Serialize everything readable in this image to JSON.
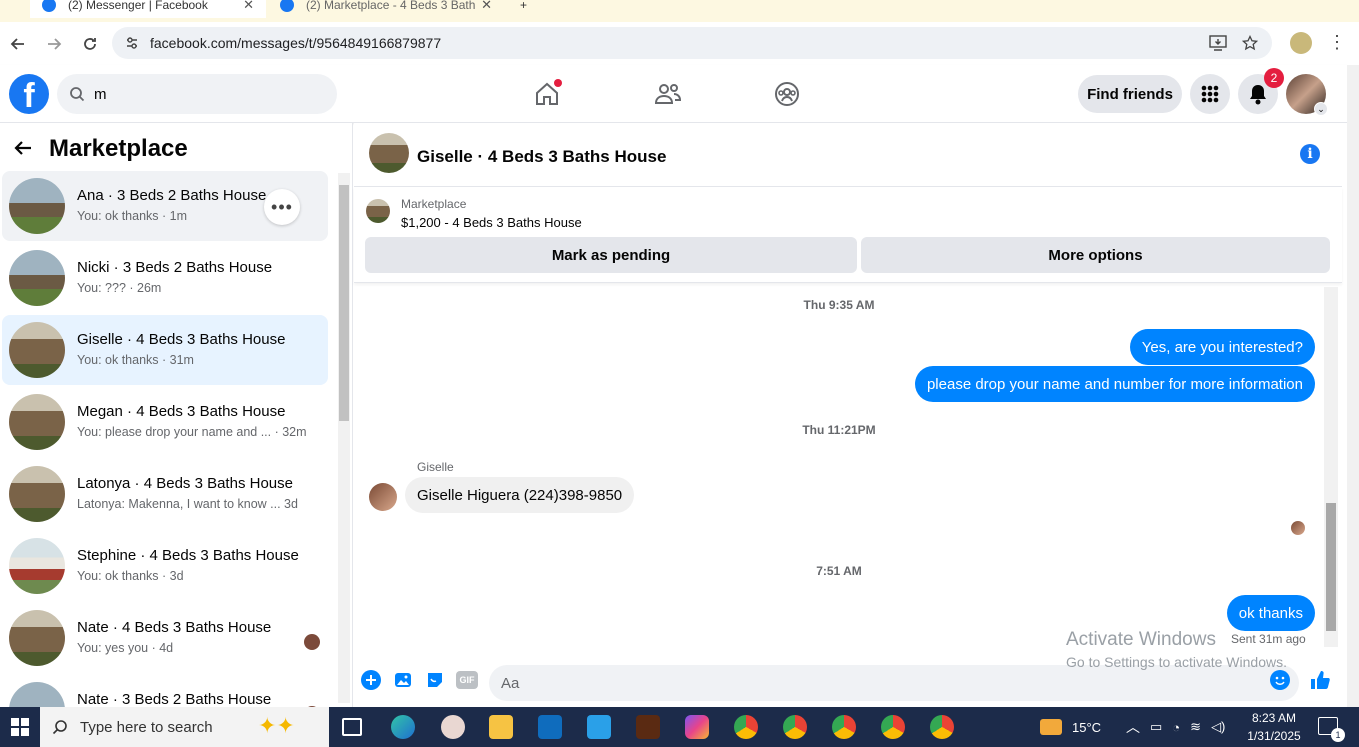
{
  "browser": {
    "tabs": [
      {
        "label": "(2) Messenger | Facebook"
      },
      {
        "label": "(2) Marketplace - 4 Beds 3 Bath"
      }
    ],
    "url": "facebook.com/messages/t/9564849166879877"
  },
  "header": {
    "search_value": "m",
    "find_friends_label": "Find friends",
    "notification_count": "2"
  },
  "sidebar": {
    "title": "Marketplace",
    "conversations": [
      {
        "name": "Ana · 3 Beds 2 Baths House",
        "preview": "You: ok thanks · 1m"
      },
      {
        "name": "Nicki · 3 Beds 2 Baths House",
        "preview": "You: ??? · 26m"
      },
      {
        "name": "Giselle · 4 Beds 3 Baths House",
        "preview": "You: ok thanks · 31m"
      },
      {
        "name": "Megan · 4 Beds 3 Baths House",
        "preview": "You: please drop your name and ... · 32m"
      },
      {
        "name": "Latonya · 4 Beds 3 Baths House",
        "preview": "Latonya: Makenna, I want to know ...  3d"
      },
      {
        "name": "Stephine · 4 Beds 3 Baths House",
        "preview": "You: ok thanks · 3d"
      },
      {
        "name": "Nate · 4 Beds 3 Baths House",
        "preview": "You: yes you · 4d"
      },
      {
        "name": "Nate · 3 Beds 2 Baths House",
        "preview": ""
      }
    ]
  },
  "chat": {
    "title": "Giselle · 4 Beds 3 Baths House",
    "marketplace_label": "Marketplace",
    "listing": "$1,200 - 4 Beds 3 Baths House",
    "mark_pending_label": "Mark as pending",
    "more_options_label": "More options",
    "timestamps": [
      "Thu 9:35 AM",
      "Thu 11:21PM",
      "7:51 AM"
    ],
    "messages": [
      {
        "text": "Yes, are you interested?"
      },
      {
        "text": "please drop your name and number for more information"
      },
      {
        "sender": "Giselle",
        "text": "Giselle Higuera (224)398-9850"
      },
      {
        "text": "ok thanks"
      }
    ],
    "sent_label": "Sent 31m ago",
    "composer_placeholder": "Aa",
    "gif_label": "GIF"
  },
  "watermark": {
    "line1": "Activate Windows",
    "line2": "Go to Settings to activate Windows."
  },
  "taskbar": {
    "search_placeholder": "Type here to search",
    "temperature": "15°C",
    "time": "8:23 AM",
    "date": "1/31/2025",
    "notification_count": "1"
  },
  "colors": {
    "fb_blue": "#1877f2",
    "bubble_blue": "#0084ff",
    "badge_red": "#e41e3f",
    "selected_bg": "#e7f3ff"
  }
}
